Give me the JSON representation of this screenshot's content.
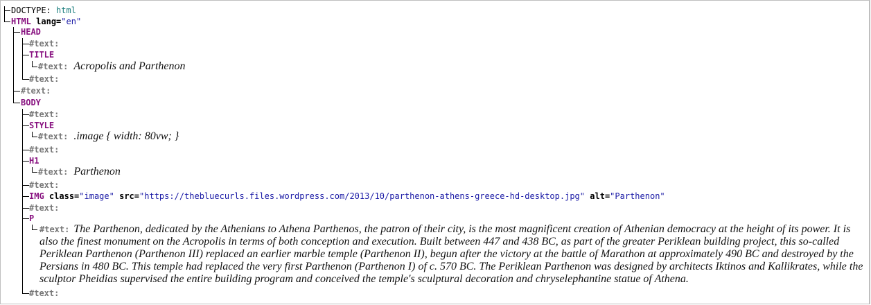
{
  "doctype": {
    "label": "DOCTYPE:",
    "value": "html"
  },
  "html": {
    "tag": "HTML",
    "attr_name": "lang",
    "attr_value": "\"en\""
  },
  "head": {
    "tag": "HEAD"
  },
  "text_label": "#text:",
  "title": {
    "tag": "TITLE",
    "text": "Acropolis and Parthenon"
  },
  "body": {
    "tag": "BODY"
  },
  "style": {
    "tag": "STYLE",
    "text": ".image { width: 80vw; }"
  },
  "h1": {
    "tag": "H1",
    "text": "Parthenon"
  },
  "img": {
    "tag": "IMG",
    "class_name": "class",
    "class_value": "\"image\"",
    "src_name": "src",
    "src_value": "\"https://thebluecurls.files.wordpress.com/2013/10/parthenon-athens-greece-hd-desktop.jpg\"",
    "alt_name": "alt",
    "alt_value": "\"Parthenon\""
  },
  "p": {
    "tag": "P",
    "text": "The Parthenon, dedicated by the Athenians to Athena Parthenos, the patron of their city, is the most magnificent creation of Athenian democracy at the height of its power. It is also the finest monument on the Acropolis in terms of both conception and execution. Built between 447 and 438 BC, as part of the greater Periklean building project, this so-called Periklean Parthenon (Parthenon III) replaced an earlier marble temple (Parthenon II), begun after the victory at the battle of Marathon at approximately 490 BC and destroyed by the Persians in 480 BC. This temple had replaced the very first Parthenon (Parthenon I) of c. 570 BC. The Periklean Parthenon was designed by architects Iktinos and Kallikrates, while the sculptor Pheidias supervised the entire building program and conceived the temple's sculptural decoration and chryselephantine statue of Athena."
  }
}
